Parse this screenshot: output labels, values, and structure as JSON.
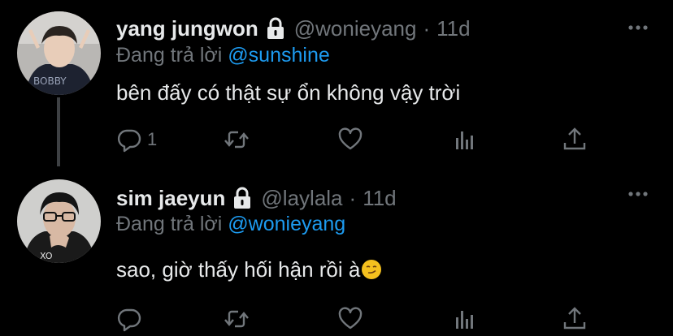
{
  "tweets": [
    {
      "display_name": "yang jungwon",
      "handle": "@wonieyang",
      "separator": "·",
      "time": "11d",
      "reply_prefix": "Đang trả lời",
      "reply_to": "@sunshine",
      "text": "bên đấy có thật sự ổn không vậy trời",
      "reply_count": "1",
      "avatar_icon": "profile-photo",
      "protected_icon": "lock-icon"
    },
    {
      "display_name": "sim jaeyun",
      "handle": "@laylala",
      "separator": "·",
      "time": "11d",
      "reply_prefix": "Đang trả lời",
      "reply_to": "@wonieyang",
      "text": "sao, giờ thấy hối hận rồi à",
      "emoji": "smirking-face",
      "reply_count": "",
      "avatar_icon": "profile-photo",
      "protected_icon": "lock-icon"
    }
  ],
  "colors": {
    "background": "#000000",
    "text": "#e7e9ea",
    "muted": "#71767b",
    "accent": "#1d9bf0"
  }
}
